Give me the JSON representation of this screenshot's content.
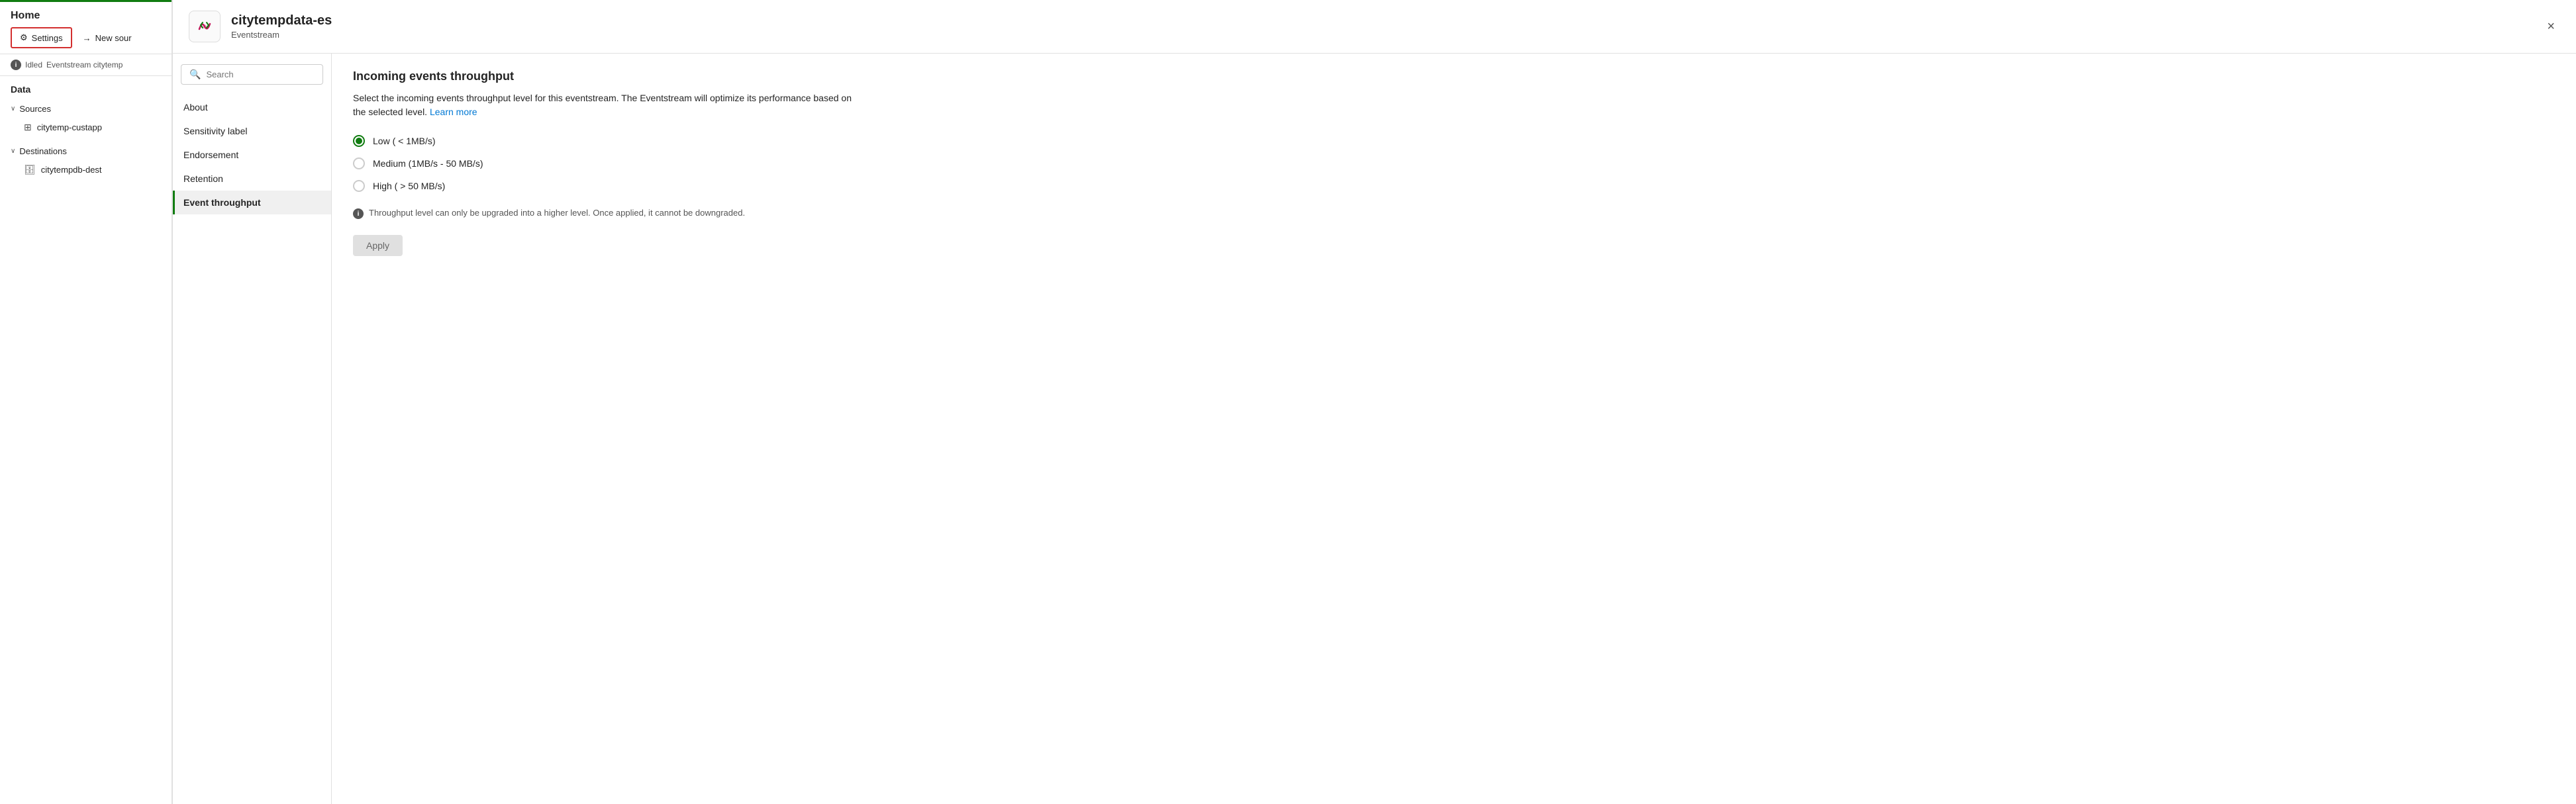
{
  "sidebar": {
    "top_accent_color": "#107c10",
    "title": "Home",
    "buttons": {
      "settings_label": "Settings",
      "new_source_label": "New sour"
    },
    "status": {
      "icon": "i",
      "state": "Idled",
      "description": "Eventstream citytemp"
    },
    "data_label": "Data",
    "sources": {
      "label": "Sources",
      "items": [
        {
          "name": "citytemp-custapp",
          "icon": "⊞"
        }
      ]
    },
    "destinations": {
      "label": "Destinations",
      "items": [
        {
          "name": "citytempdb-dest",
          "icon": "🗄"
        }
      ]
    }
  },
  "modal": {
    "title": "citytempdata-es",
    "subtitle": "Eventstream",
    "close_label": "×",
    "search": {
      "placeholder": "Search"
    },
    "nav_items": [
      {
        "id": "about",
        "label": "About",
        "active": false
      },
      {
        "id": "sensitivity",
        "label": "Sensitivity label",
        "active": false
      },
      {
        "id": "endorsement",
        "label": "Endorsement",
        "active": false
      },
      {
        "id": "retention",
        "label": "Retention",
        "active": false
      },
      {
        "id": "event_throughput",
        "label": "Event throughput",
        "active": true
      }
    ],
    "content": {
      "title": "Incoming events throughput",
      "description_part1": "Select the incoming events throughput level for this eventstream. The Eventstream will optimize its performance based on the selected level.",
      "learn_more_label": "Learn more",
      "options": [
        {
          "id": "low",
          "label": "Low ( < 1MB/s)",
          "selected": true
        },
        {
          "id": "medium",
          "label": "Medium (1MB/s - 50 MB/s)",
          "selected": false
        },
        {
          "id": "high",
          "label": "High ( > 50 MB/s)",
          "selected": false
        }
      ],
      "warning_text": "Throughput level can only be upgraded into a higher level. Once applied, it cannot be downgraded.",
      "apply_button_label": "Apply"
    }
  },
  "icons": {
    "settings": "⚙",
    "new_source": "→",
    "search": "🔍",
    "close": "✕",
    "chevron_down": "∨",
    "info": "i"
  }
}
